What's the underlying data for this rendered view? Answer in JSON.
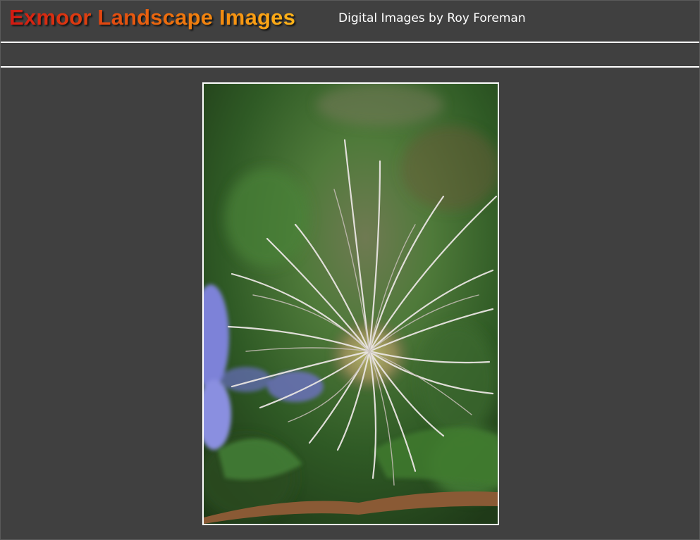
{
  "header": {
    "site_title": "Exmoor Landscape Images",
    "tagline": "Digital Images by Roy Foreman"
  },
  "photo": {
    "subject": "clematis-seedhead-photo",
    "colors": {
      "background_green": "#3d6b2e",
      "bloom_purple": "#7d82d8",
      "seed_filaments": "#e8e4e0",
      "stem_brown": "#8a5a35"
    }
  }
}
